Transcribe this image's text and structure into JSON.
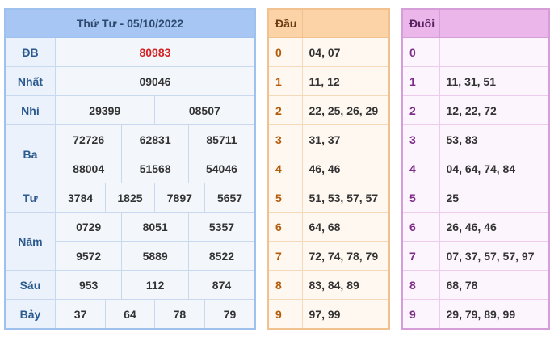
{
  "result": {
    "title": "Thứ Tư - 05/10/2022",
    "rows": [
      {
        "label": "ĐB",
        "values": [
          "80983"
        ]
      },
      {
        "label": "Nhất",
        "values": [
          "09046"
        ]
      },
      {
        "label": "Nhì",
        "values": [
          "29399",
          "08507"
        ]
      },
      {
        "label": "Ba",
        "values": [
          "72726",
          "62831",
          "85711",
          "88004",
          "51568",
          "54046"
        ]
      },
      {
        "label": "Tư",
        "values": [
          "3784",
          "1825",
          "7897",
          "5657"
        ]
      },
      {
        "label": "Năm",
        "values": [
          "0729",
          "8051",
          "5357",
          "9572",
          "5889",
          "8522"
        ]
      },
      {
        "label": "Sáu",
        "values": [
          "953",
          "112",
          "874"
        ]
      },
      {
        "label": "Bảy",
        "values": [
          "37",
          "64",
          "78",
          "79"
        ]
      }
    ]
  },
  "head": {
    "header": "Đầu",
    "rows": [
      {
        "digit": "0",
        "values": "04, 07"
      },
      {
        "digit": "1",
        "values": "11, 12"
      },
      {
        "digit": "2",
        "values": "22, 25, 26, 29"
      },
      {
        "digit": "3",
        "values": "31, 37"
      },
      {
        "digit": "4",
        "values": "46, 46"
      },
      {
        "digit": "5",
        "values": "51, 53, 57, 57"
      },
      {
        "digit": "6",
        "values": "64, 68"
      },
      {
        "digit": "7",
        "values": "72, 74, 78, 79"
      },
      {
        "digit": "8",
        "values": "83, 84, 89"
      },
      {
        "digit": "9",
        "values": "97, 99"
      }
    ]
  },
  "tail": {
    "header": "Đuôi",
    "rows": [
      {
        "digit": "0",
        "values": ""
      },
      {
        "digit": "1",
        "values": "11, 31, 51"
      },
      {
        "digit": "2",
        "values": "12, 22, 72"
      },
      {
        "digit": "3",
        "values": "53, 83"
      },
      {
        "digit": "4",
        "values": "04, 64, 74, 84"
      },
      {
        "digit": "5",
        "values": "25"
      },
      {
        "digit": "6",
        "values": "26, 46, 46"
      },
      {
        "digit": "7",
        "values": "07, 37, 57, 57, 97"
      },
      {
        "digit": "8",
        "values": "68, 78"
      },
      {
        "digit": "9",
        "values": "29, 79, 89, 99"
      }
    ]
  },
  "colors": {
    "result_header": "#a7c6f4",
    "head_header": "#fcd3a7",
    "tail_header": "#ebb7ea",
    "special_prize": "#d42121"
  }
}
